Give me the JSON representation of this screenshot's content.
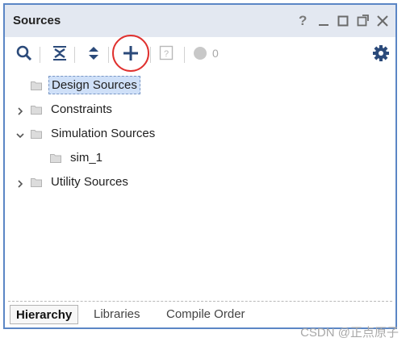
{
  "panel": {
    "title": "Sources"
  },
  "window_controls": [
    "?",
    "_",
    "□",
    "⇱",
    "✕"
  ],
  "toolbar": {
    "items": [
      {
        "name": "search",
        "icon": "search-icon"
      },
      {
        "name": "collapse-all",
        "icon": "collapse-all-icon"
      },
      {
        "name": "expand-all",
        "icon": "expand-all-icon"
      },
      {
        "name": "add-sources",
        "icon": "plus-icon"
      },
      {
        "name": "help",
        "icon": "help-icon"
      },
      {
        "name": "status-count",
        "icon": "status-dot-icon",
        "count": "0"
      },
      {
        "name": "settings",
        "icon": "gear-icon"
      }
    ],
    "count_label": "0"
  },
  "tree": {
    "items": [
      {
        "label": "Design Sources",
        "expandable": false,
        "expanded": false,
        "level": 0,
        "selected": true
      },
      {
        "label": "Constraints",
        "expandable": true,
        "expanded": false,
        "level": 0,
        "selected": false
      },
      {
        "label": "Simulation Sources",
        "expandable": true,
        "expanded": true,
        "level": 0,
        "selected": false
      },
      {
        "label": "sim_1",
        "expandable": false,
        "expanded": false,
        "level": 1,
        "selected": false
      },
      {
        "label": "Utility Sources",
        "expandable": true,
        "expanded": false,
        "level": 0,
        "selected": false
      }
    ]
  },
  "tabs": [
    {
      "label": "Hierarchy",
      "active": true
    },
    {
      "label": "Libraries",
      "active": false
    },
    {
      "label": "Compile Order",
      "active": false
    }
  ],
  "watermark": "CSDN @正点原子",
  "colors": {
    "title_bar": "#e3e8f1",
    "border": "#5b86c5",
    "highlight_ring": "#e0312f",
    "selection": "#cfe0f8"
  }
}
